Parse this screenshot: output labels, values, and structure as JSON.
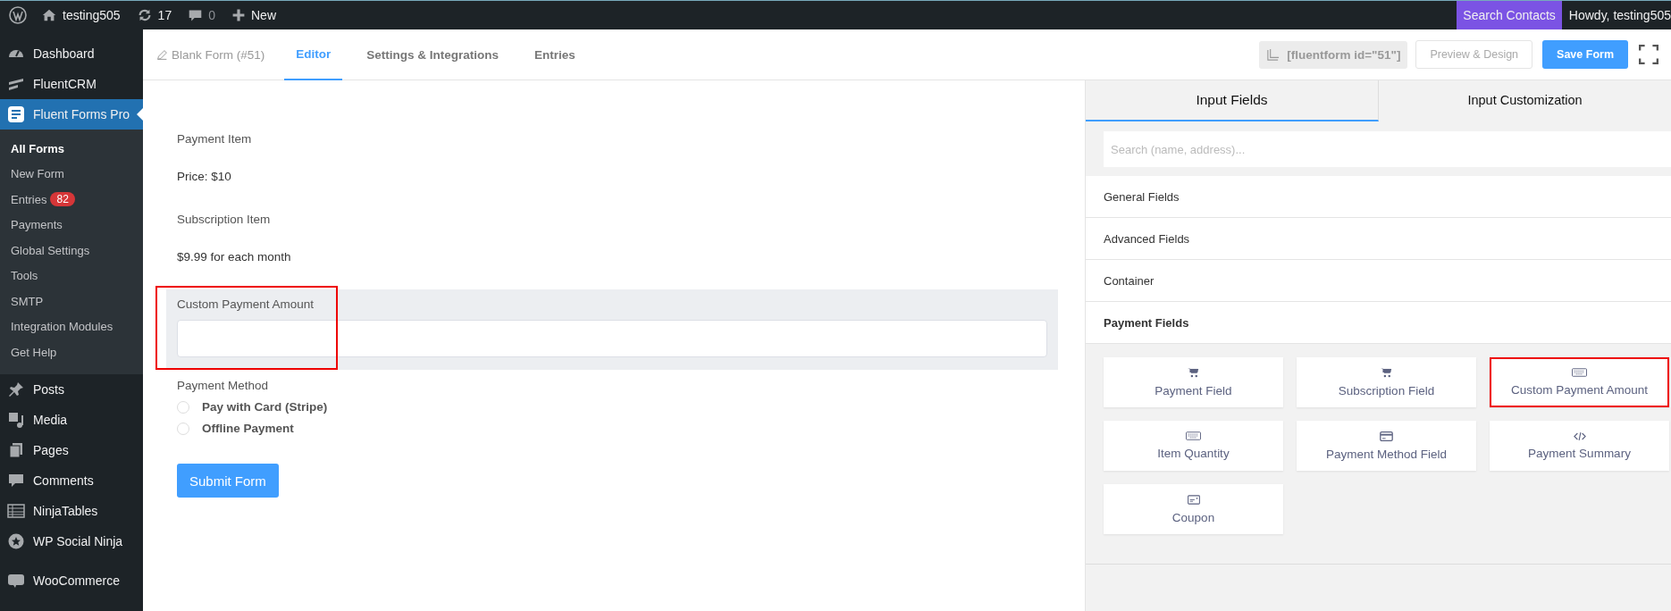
{
  "admin_bar": {
    "site": "testing505",
    "updates": "17",
    "comments": "0",
    "new": "New",
    "search_contacts": "Search Contacts",
    "greeting": "Howdy, testing505"
  },
  "sidebar": {
    "items": [
      {
        "label": "Dashboard",
        "kind": "gauge",
        "selected": false
      },
      {
        "label": "FluentCRM",
        "kind": "crm",
        "selected": false
      },
      {
        "label": "Fluent Forms Pro",
        "kind": "forms",
        "selected": true,
        "children": [
          {
            "label": "All Forms",
            "selected": true
          },
          {
            "label": "New Form",
            "selected": false
          },
          {
            "label": "Entries",
            "selected": false,
            "badge": "82"
          },
          {
            "label": "Payments",
            "selected": false
          },
          {
            "label": "Global Settings",
            "selected": false
          },
          {
            "label": "Tools",
            "selected": false
          },
          {
            "label": "SMTP",
            "selected": false
          },
          {
            "label": "Integration Modules",
            "selected": false
          },
          {
            "label": "Get Help",
            "selected": false
          }
        ]
      },
      {
        "label": "Posts",
        "kind": "pin",
        "selected": false
      },
      {
        "label": "Media",
        "kind": "media",
        "selected": false
      },
      {
        "label": "Pages",
        "kind": "pages",
        "selected": false
      },
      {
        "label": "Comments",
        "kind": "comment",
        "selected": false
      },
      {
        "label": "NinjaTables",
        "kind": "table",
        "selected": false
      },
      {
        "label": "WP Social Ninja",
        "kind": "star",
        "selected": false
      },
      {
        "label": "WooCommerce",
        "kind": "woo",
        "selected": false
      }
    ]
  },
  "header": {
    "form_name": "Blank Form (#51)",
    "tabs": [
      {
        "label": "Editor",
        "selected": true
      },
      {
        "label": "Settings & Integrations",
        "selected": false
      },
      {
        "label": "Entries",
        "selected": false
      }
    ],
    "shortcode": "[fluentform id=\"51\"]",
    "preview_button": "Preview & Design",
    "save_button": "Save Form"
  },
  "form": {
    "items": [
      {
        "kind": "text",
        "label": "Payment Item",
        "value": "Price: $10"
      },
      {
        "kind": "text",
        "label": "Subscription Item",
        "value": "$9.99 for each month"
      },
      {
        "kind": "input",
        "label": "Custom Payment Amount",
        "highlighted": true
      },
      {
        "kind": "radio",
        "label": "Payment Method",
        "options": [
          {
            "label": "Pay with Card (Stripe)",
            "checked": false
          },
          {
            "label": "Offline Payment",
            "checked": false
          }
        ]
      }
    ],
    "submit": "Submit Form"
  },
  "panel": {
    "tabs": [
      {
        "label": "Input Fields",
        "selected": true
      },
      {
        "label": "Input Customization",
        "selected": false
      }
    ],
    "search": {
      "placeholder": "Search (name, address)..."
    },
    "sections": [
      {
        "label": "General Fields",
        "expanded": false
      },
      {
        "label": "Advanced Fields",
        "expanded": false
      },
      {
        "label": "Container",
        "expanded": false
      },
      {
        "label": "Payment Fields",
        "expanded": true
      }
    ],
    "fields": [
      {
        "label": "Payment Field",
        "kind": "cart",
        "highlighted": false
      },
      {
        "label": "Subscription Field",
        "kind": "cart",
        "highlighted": false
      },
      {
        "label": "Custom Payment Amount",
        "kind": "keyboard",
        "highlighted": true
      },
      {
        "label": "Item Quantity",
        "kind": "keyboard",
        "highlighted": false
      },
      {
        "label": "Payment Method Field",
        "kind": "card",
        "highlighted": false
      },
      {
        "label": "Payment Summary",
        "kind": "code",
        "highlighted": false
      },
      {
        "label": "Coupon",
        "kind": "coupon",
        "highlighted": false
      }
    ]
  }
}
